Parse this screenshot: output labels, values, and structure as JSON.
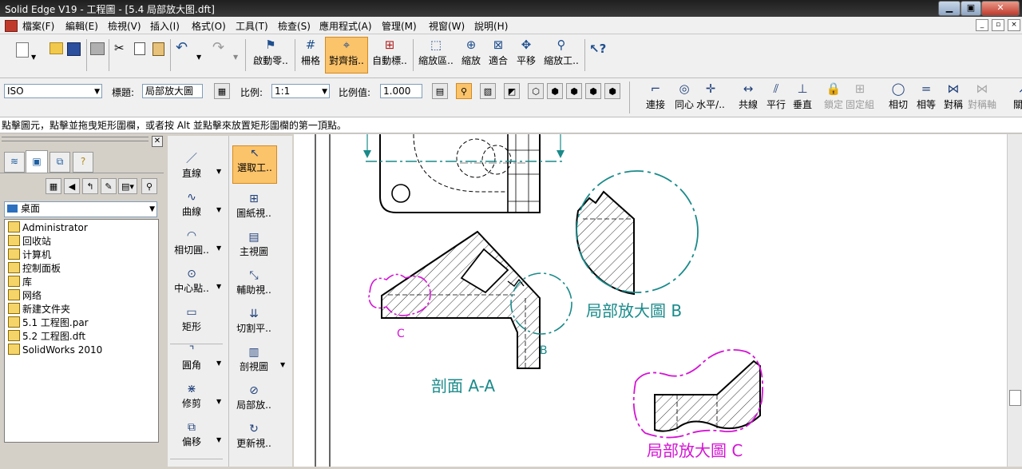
{
  "window": {
    "title": "Solid Edge V19 - 工程圖 - [5.4 局部放大图.dft]",
    "minimize": "▁",
    "restore": "▣",
    "close": "✕"
  },
  "menu": [
    "檔案(F)",
    "編輯(E)",
    "檢視(V)",
    "插入(I)",
    "格式(O)",
    "工具(T)",
    "檢查(S)",
    "應用程式(A)",
    "管理(M)",
    "視窗(W)",
    "說明(H)"
  ],
  "mdi_controls": [
    "_",
    "▫",
    "×"
  ],
  "toolbar_main": [
    {
      "label": "啟動零..",
      "icon": "pin-icon"
    },
    {
      "label": "柵格",
      "icon": "grid-icon"
    },
    {
      "label": "對齊指..",
      "icon": "align-indicator-icon"
    },
    {
      "label": "自動標..",
      "icon": "auto-dimension-icon"
    },
    {
      "label": "縮放區..",
      "icon": "zoom-area-icon"
    },
    {
      "label": "縮放",
      "icon": "zoom-icon"
    },
    {
      "label": "適合",
      "icon": "fit-icon"
    },
    {
      "label": "平移",
      "icon": "pan-icon"
    },
    {
      "label": "縮放工..",
      "icon": "zoom-tool-icon"
    }
  ],
  "properties": {
    "style_value": "ISO",
    "title_label": "標題:",
    "title_value": "局部放大圖",
    "scale_label": "比例:",
    "scale_value": "1:1",
    "scale_value_label": "比例值:",
    "scale_number": "1.000"
  },
  "relations": [
    {
      "label": "連接",
      "icon": "connect-icon",
      "enabled": true
    },
    {
      "label": "同心",
      "icon": "concentric-icon",
      "enabled": true
    },
    {
      "label": "水平/..",
      "icon": "horizontal-vertical-icon",
      "enabled": true
    },
    {
      "label": "共線",
      "icon": "collinear-icon",
      "enabled": true
    },
    {
      "label": "平行",
      "icon": "parallel-icon",
      "enabled": true
    },
    {
      "label": "垂直",
      "icon": "perpendicular-icon",
      "enabled": true
    },
    {
      "label": "鎖定",
      "icon": "lock-icon",
      "enabled": false
    },
    {
      "label": "固定組",
      "icon": "rigid-set-icon",
      "enabled": false
    },
    {
      "label": "相切",
      "icon": "tangent-icon",
      "enabled": true
    },
    {
      "label": "相等",
      "icon": "equal-icon",
      "enabled": true
    },
    {
      "label": "對稱",
      "icon": "symmetric-icon",
      "enabled": true
    },
    {
      "label": "對稱軸",
      "icon": "symmetry-axis-icon",
      "enabled": false
    },
    {
      "label": "關聯",
      "icon": "relation-icon",
      "enabled": true
    }
  ],
  "prompt": "點擊圖元，點擊並拖曳矩形圍欄，或者按 Alt 並點擊來放置矩形圍欄的第一頂點。",
  "location": "桌面",
  "tree": [
    {
      "label": "Administrator",
      "icon": "user-folder-icon"
    },
    {
      "label": "回收站",
      "icon": "recycle-bin-icon"
    },
    {
      "label": "计算机",
      "icon": "computer-icon"
    },
    {
      "label": "控制面板",
      "icon": "control-panel-icon"
    },
    {
      "label": "库",
      "icon": "library-icon"
    },
    {
      "label": "网络",
      "icon": "network-icon"
    },
    {
      "label": "新建文件夹",
      "icon": "folder-icon"
    },
    {
      "label": "5.1 工程图.par",
      "icon": "part-file-icon"
    },
    {
      "label": "5.2 工程图.dft",
      "icon": "draft-file-icon"
    },
    {
      "label": "SolidWorks 2010",
      "icon": "solidworks-icon"
    }
  ],
  "draw_tools": [
    {
      "label": "直線",
      "icon": "line-icon"
    },
    {
      "label": "曲線",
      "icon": "curve-icon"
    },
    {
      "label": "相切圓..",
      "icon": "tangent-circle-icon"
    },
    {
      "label": "中心點..",
      "icon": "center-point-icon"
    },
    {
      "label": "矩形",
      "icon": "rectangle-icon"
    },
    {
      "label": "圓角",
      "icon": "fillet-icon"
    },
    {
      "label": "修剪",
      "icon": "trim-icon"
    },
    {
      "label": "偏移",
      "icon": "offset-icon"
    }
  ],
  "view_tools": [
    {
      "label": "選取工..",
      "icon": "select-tool-icon"
    },
    {
      "label": "圖紙視..",
      "icon": "drawing-view-icon"
    },
    {
      "label": "主視圖",
      "icon": "principal-view-icon"
    },
    {
      "label": "輔助視..",
      "icon": "auxiliary-view-icon"
    },
    {
      "label": "切割平..",
      "icon": "cutting-plane-icon"
    },
    {
      "label": "剖視圖",
      "icon": "section-view-icon"
    },
    {
      "label": "局部放..",
      "icon": "detail-view-icon"
    },
    {
      "label": "更新視..",
      "icon": "update-view-icon"
    }
  ],
  "drawing": {
    "detail_b_label": "局部放大圖 B",
    "detail_c_label": "局部放大圖 C",
    "section_label": "剖面 A-A",
    "callout_b": "B",
    "callout_c": "C",
    "teal": "#1a8a8a",
    "magenta": "#d414d4"
  }
}
